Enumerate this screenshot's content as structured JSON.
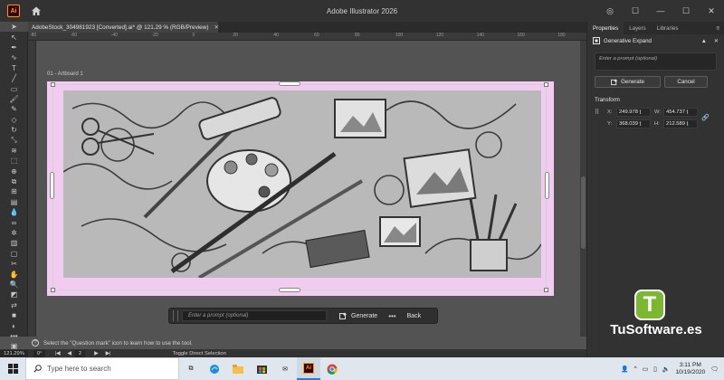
{
  "titlebar": {
    "app_title": "Adobe Illustrator 2026",
    "logo": "Ai",
    "controls": [
      "—",
      "☐",
      "✕"
    ],
    "extra_controls": [
      "◎",
      "☐"
    ]
  },
  "doc_tab": {
    "title": "AdobeStock_304981923 [Converted].ai* @ 121.29 % (RGB/Preview)",
    "close": "✕"
  },
  "ruler": {
    "ticks": [
      "-80",
      "-70",
      "-60",
      "-50",
      "-40",
      "-30",
      "-20",
      "-10",
      "0",
      "10",
      "20",
      "30",
      "40",
      "50",
      "60",
      "70",
      "80",
      "90",
      "100",
      "110",
      "120",
      "130",
      "140",
      "150",
      "160",
      "170",
      "180",
      "190",
      "200",
      "210",
      "220",
      "230",
      "240",
      "250",
      "260",
      "270",
      "280",
      "290",
      "300",
      "310",
      "320",
      "330",
      "340",
      "350",
      "360",
      "370",
      "380",
      "390",
      "400",
      "410",
      "420",
      "430",
      "440",
      "450",
      "460"
    ]
  },
  "canvas": {
    "artboard_label": "01 - Artboard 1",
    "artwork_desc_color": "#bcbcbc"
  },
  "context_bar": {
    "prompt_placeholder": "Enter a prompt (optional)",
    "generate_label": "Generate",
    "more": "•••",
    "back_label": "Back"
  },
  "status_help": "Select the \"Question mark\" icon to learn how to use the tool.",
  "statusbar": {
    "zoom": "121.29%",
    "rotation": "0°",
    "artboard_num": "2",
    "tool_name": "Toggle Direct Selection"
  },
  "right_panel": {
    "tabs": [
      "Properties",
      "Layers",
      "Libraries"
    ],
    "menu": "≡",
    "section_title": "Generative Expand",
    "prompt_placeholder": "Enter a prompt (optional)",
    "generate_btn": "Generate",
    "cancel_btn": "Cancel",
    "transform_title": "Transform",
    "x_label": "X:",
    "x_val": "249.978 ţ",
    "y_label": "Y:",
    "y_val": "368.039 ţ",
    "w_label": "W:",
    "w_val": "454.737 ţ",
    "h_label": "H:",
    "h_val": "212.589 ţ"
  },
  "watermark": {
    "badge": "T",
    "text": "TuSoftware.es"
  },
  "taskbar": {
    "search_placeholder": "Type here to search",
    "time": "3:11 PM",
    "date": "10/19/2020"
  },
  "colors": {
    "accent": "#ff9a00",
    "artboard_pink": "#f2ccf0",
    "watermark_green": "#7cb82f"
  }
}
